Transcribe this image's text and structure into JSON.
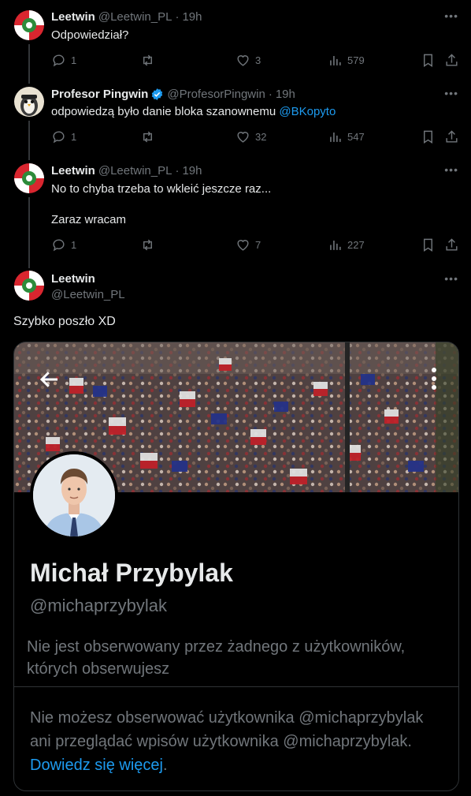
{
  "tweets": [
    {
      "name": "Leetwin",
      "handle": "@Leetwin_PL",
      "dot": "·",
      "time": "19h",
      "text": "Odpowiedział?",
      "replies": "1",
      "likes": "3",
      "views": "579"
    },
    {
      "name": "Profesor Pingwin",
      "handle": "@ProfesorPingwin",
      "dot": "·",
      "time": "19h",
      "text": "odpowiedzą było danie bloka szanownemu ",
      "mention": "@BKopyto",
      "replies": "1",
      "likes": "32",
      "views": "547"
    },
    {
      "name": "Leetwin",
      "handle": "@Leetwin_PL",
      "dot": "·",
      "time": "19h",
      "text_line1": "No to chyba trzeba to wkleić jeszcze raz...",
      "text_line2": "Zaraz wracam",
      "replies": "1",
      "likes": "7",
      "views": "227"
    }
  ],
  "main_tweet": {
    "name": "Leetwin",
    "handle": "@Leetwin_PL",
    "text": "Szybko poszło XD"
  },
  "profile_card": {
    "display_name": "Michał Przybylak",
    "handle": "@michaprzybylak",
    "follow_info": "Nie jest obserwowany przez żadnego z użytkowników, których obserwujesz",
    "blocked_note": "Nie możesz obserwować użytkownika @michaprzybylak ani przeglądać wpisów użytkownika @michaprzybylak. ",
    "learn_more": "Dowiedz się więcej",
    "learn_more_suffix": "."
  },
  "colors": {
    "background": "#000000",
    "text": "#e7e9ea",
    "muted": "#71767b",
    "accent": "#1d9bf0",
    "border": "#2f3336"
  }
}
